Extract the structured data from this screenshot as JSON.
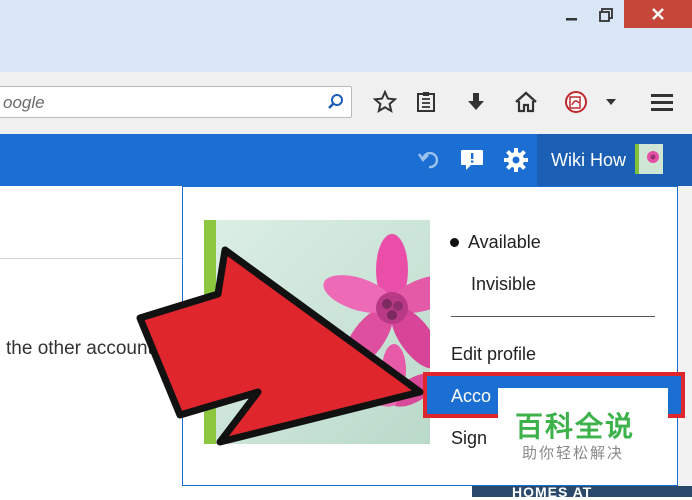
{
  "window": {
    "minimize_icon": "minimize-icon",
    "maximize_icon": "restore-icon",
    "close_icon": "close-icon"
  },
  "toolbar": {
    "url_text": "oogle",
    "icons": [
      "search-icon",
      "star-icon",
      "reading-list-icon",
      "download-icon",
      "home-icon",
      "pdf-icon",
      "chevron-down-icon",
      "menu-icon"
    ]
  },
  "app_header": {
    "user_name": "Wiki How",
    "icons": [
      "undo-icon",
      "feedback-icon",
      "gear-icon"
    ],
    "color": "#1c6fd2"
  },
  "page": {
    "body_text": "the other account c"
  },
  "profile_menu": {
    "status_available": "Available",
    "status_invisible": "Invisible",
    "edit_profile": "Edit profile",
    "account_settings": "Acco",
    "sign_out": "Sign"
  },
  "overlay": {
    "bottom_banner": "HOMES AT",
    "watermark_main": "百科全说",
    "watermark_sub": "助你轻松解决",
    "arrow_color": "#e0262d"
  }
}
